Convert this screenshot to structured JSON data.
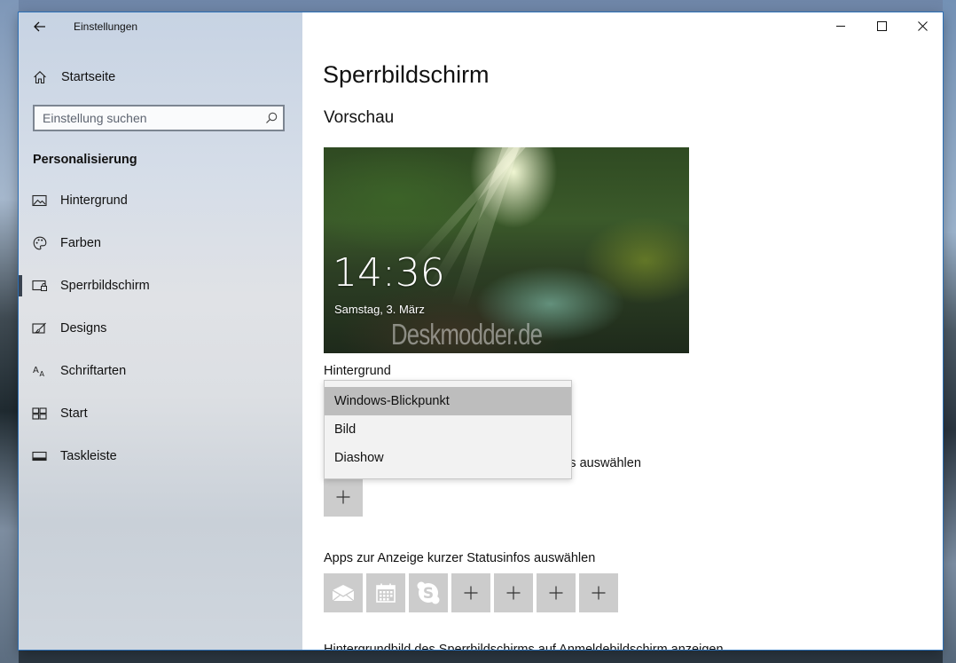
{
  "window": {
    "app_title": "Einstellungen"
  },
  "sidebar": {
    "home_label": "Startseite",
    "search_placeholder": "Einstellung suchen",
    "section_title": "Personalisierung",
    "items": [
      {
        "label": "Hintergrund",
        "icon": "picture-icon"
      },
      {
        "label": "Farben",
        "icon": "palette-icon"
      },
      {
        "label": "Sperrbildschirm",
        "icon": "lock-screen-icon",
        "active": true
      },
      {
        "label": "Designs",
        "icon": "brush-icon"
      },
      {
        "label": "Schriftarten",
        "icon": "font-icon"
      },
      {
        "label": "Start",
        "icon": "start-icon"
      },
      {
        "label": "Taskleiste",
        "icon": "taskbar-icon"
      }
    ]
  },
  "main": {
    "title": "Sperrbildschirm",
    "preview_title": "Vorschau",
    "preview": {
      "time": "14:36",
      "date": "Samstag, 3. März",
      "watermark": "Deskmodder.de"
    },
    "background_label": "Hintergrund",
    "background_options": [
      "Windows-Blickpunkt",
      "Bild",
      "Diashow"
    ],
    "background_selected": "Windows-Blickpunkt",
    "detail_status_label_partial": "os auswählen",
    "quick_status_label": "Apps zur Anzeige kurzer Statusinfos auswählen",
    "quick_status_apps": [
      "mail-icon",
      "calendar-icon",
      "skype-icon",
      "add-icon",
      "add-icon",
      "add-icon",
      "add-icon"
    ],
    "bottom_partial": "Hintergrundbild des Sperrbildschirms auf Anmeldebildschirm anzeigen"
  },
  "colors": {
    "tile_bg": "#cccccc",
    "selected_option_bg": "#bdbdbd",
    "active_indicator": "#3a4350"
  }
}
